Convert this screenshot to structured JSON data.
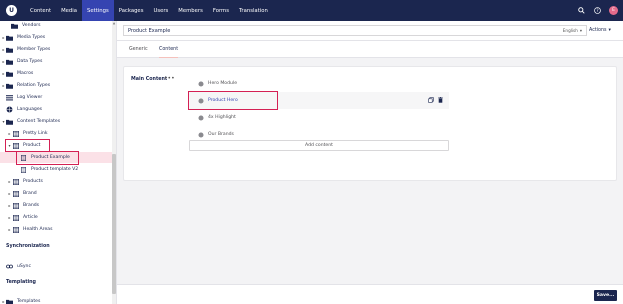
{
  "topnav": {
    "logo_letter": "U",
    "items": [
      {
        "label": "Content"
      },
      {
        "label": "Media"
      },
      {
        "label": "Settings",
        "active": true
      },
      {
        "label": "Packages"
      },
      {
        "label": "Users"
      },
      {
        "label": "Members"
      },
      {
        "label": "Forms"
      },
      {
        "label": "Translation"
      }
    ],
    "avatar_initials": "E"
  },
  "sidebar": {
    "items": [
      {
        "label": "Vendors",
        "icon": "folder-icon"
      },
      {
        "label": "Media Types",
        "icon": "folder-icon"
      },
      {
        "label": "Member Types",
        "icon": "folder-icon"
      },
      {
        "label": "Data Types",
        "icon": "folder-icon"
      },
      {
        "label": "Macros",
        "icon": "folder-icon"
      },
      {
        "label": "Relation Types",
        "icon": "folder-icon"
      },
      {
        "label": "Log Viewer",
        "icon": "list-icon"
      },
      {
        "label": "Languages",
        "icon": "globe-icon"
      },
      {
        "label": "Content Templates",
        "icon": "folder-icon"
      },
      {
        "label": "Pretty Link",
        "icon": "grid-icon"
      },
      {
        "label": "Product",
        "icon": "grid-icon"
      },
      {
        "label": "Product Example",
        "icon": "document-icon"
      },
      {
        "label": "Product template V2",
        "icon": "document-icon"
      },
      {
        "label": "Products",
        "icon": "grid-icon"
      },
      {
        "label": "Brand",
        "icon": "grid-icon"
      },
      {
        "label": "Brands",
        "icon": "grid-icon"
      },
      {
        "label": "Article",
        "icon": "grid-icon"
      },
      {
        "label": "Health Areas",
        "icon": "grid-icon"
      }
    ],
    "sections": [
      {
        "title": "Synchronization"
      },
      {
        "title": "Templating"
      }
    ],
    "usync_label": "uSync",
    "templates_label": "Templates"
  },
  "header": {
    "name_value": "Product Example",
    "language": "English",
    "actions_label": "Actions"
  },
  "tabs": [
    {
      "label": "Generic"
    },
    {
      "label": "Content",
      "active": true
    }
  ],
  "editor": {
    "property_label": "Main Content",
    "property_menu": "•••",
    "blocks": [
      {
        "label": "Hero Module"
      },
      {
        "label": "Product Hero"
      },
      {
        "label": "4x Highlight"
      },
      {
        "label": "Our Brands"
      }
    ],
    "add_content_label": "Add content"
  },
  "footer": {
    "save_label": "Save..."
  },
  "colors": {
    "topbar": "#1b264f",
    "active_nav": "#3544b1",
    "highlight_box": "#d42054",
    "selected_row": "#fbe1e7"
  }
}
